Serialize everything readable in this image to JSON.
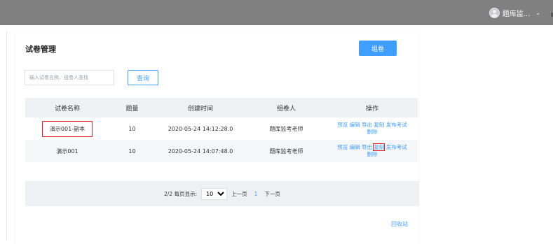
{
  "header": {
    "user_name": "题库监...",
    "chevron": "⌄"
  },
  "page": {
    "title": "试卷管理",
    "compose_button": "组卷"
  },
  "search": {
    "placeholder": "输入试卷名称、组卷人查找",
    "value": "",
    "button": "查询"
  },
  "table": {
    "columns": [
      "试卷名称",
      "题量",
      "创建时间",
      "组卷人",
      "操作"
    ],
    "rows": [
      {
        "name": "演示001-副本",
        "count": "10",
        "created": "2020-05-24 14:12:28.0",
        "author": "题库监考老师",
        "actions": [
          "预览",
          "编辑",
          "导出",
          "复制",
          "发布考试",
          "删除"
        ]
      },
      {
        "name": "演示001",
        "count": "10",
        "created": "2020-05-24 14:07:48.0",
        "author": "题库监考老师",
        "actions": [
          "预览",
          "编辑",
          "导出",
          "复制",
          "发布考试",
          "删除"
        ]
      }
    ]
  },
  "pagination": {
    "summary": "2/2 每页显示:",
    "page_size": "10",
    "prev": "上一页",
    "current": "1",
    "next": "下一页"
  },
  "footer": {
    "recycle_bin": "回收站"
  },
  "colors": {
    "topbar": "#808080",
    "primary": "#409eff",
    "highlight": "#e02020",
    "table_header": "#eef0f4"
  }
}
